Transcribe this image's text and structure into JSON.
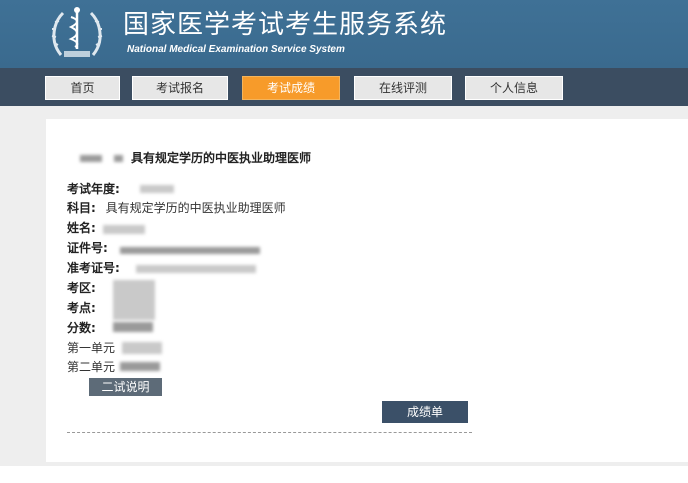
{
  "header": {
    "title_zh": "国家医学考试考生服务系统",
    "title_en": "National Medical Examination Service System"
  },
  "nav": [
    {
      "label": "首页",
      "active": false
    },
    {
      "label": "考试报名",
      "active": false
    },
    {
      "label": "考试成绩",
      "active": true
    },
    {
      "label": "在线评测",
      "active": false
    },
    {
      "label": "个人信息",
      "active": false
    }
  ],
  "result": {
    "heading": "具有规定学历的中医执业助理医师",
    "fields": {
      "year_label": "考试年度:",
      "subject_label": "科目:",
      "subject_value": "具有规定学历的中医执业助理医师",
      "name_label": "姓名:",
      "id_label": "证件号:",
      "ticket_label": "准考证号:",
      "district_label": "考区:",
      "site_label": "考点:",
      "score_label": "分数:",
      "unit1_label": "第一单元",
      "unit2_label": "第二单元"
    },
    "exam_note_button": "二试说明",
    "score_sheet_button": "成绩单"
  },
  "colors": {
    "header_bg": "#3f7196",
    "nav_bg": "#3b4d61",
    "nav_active": "#f79b2a",
    "button_dark": "#3b5068"
  }
}
